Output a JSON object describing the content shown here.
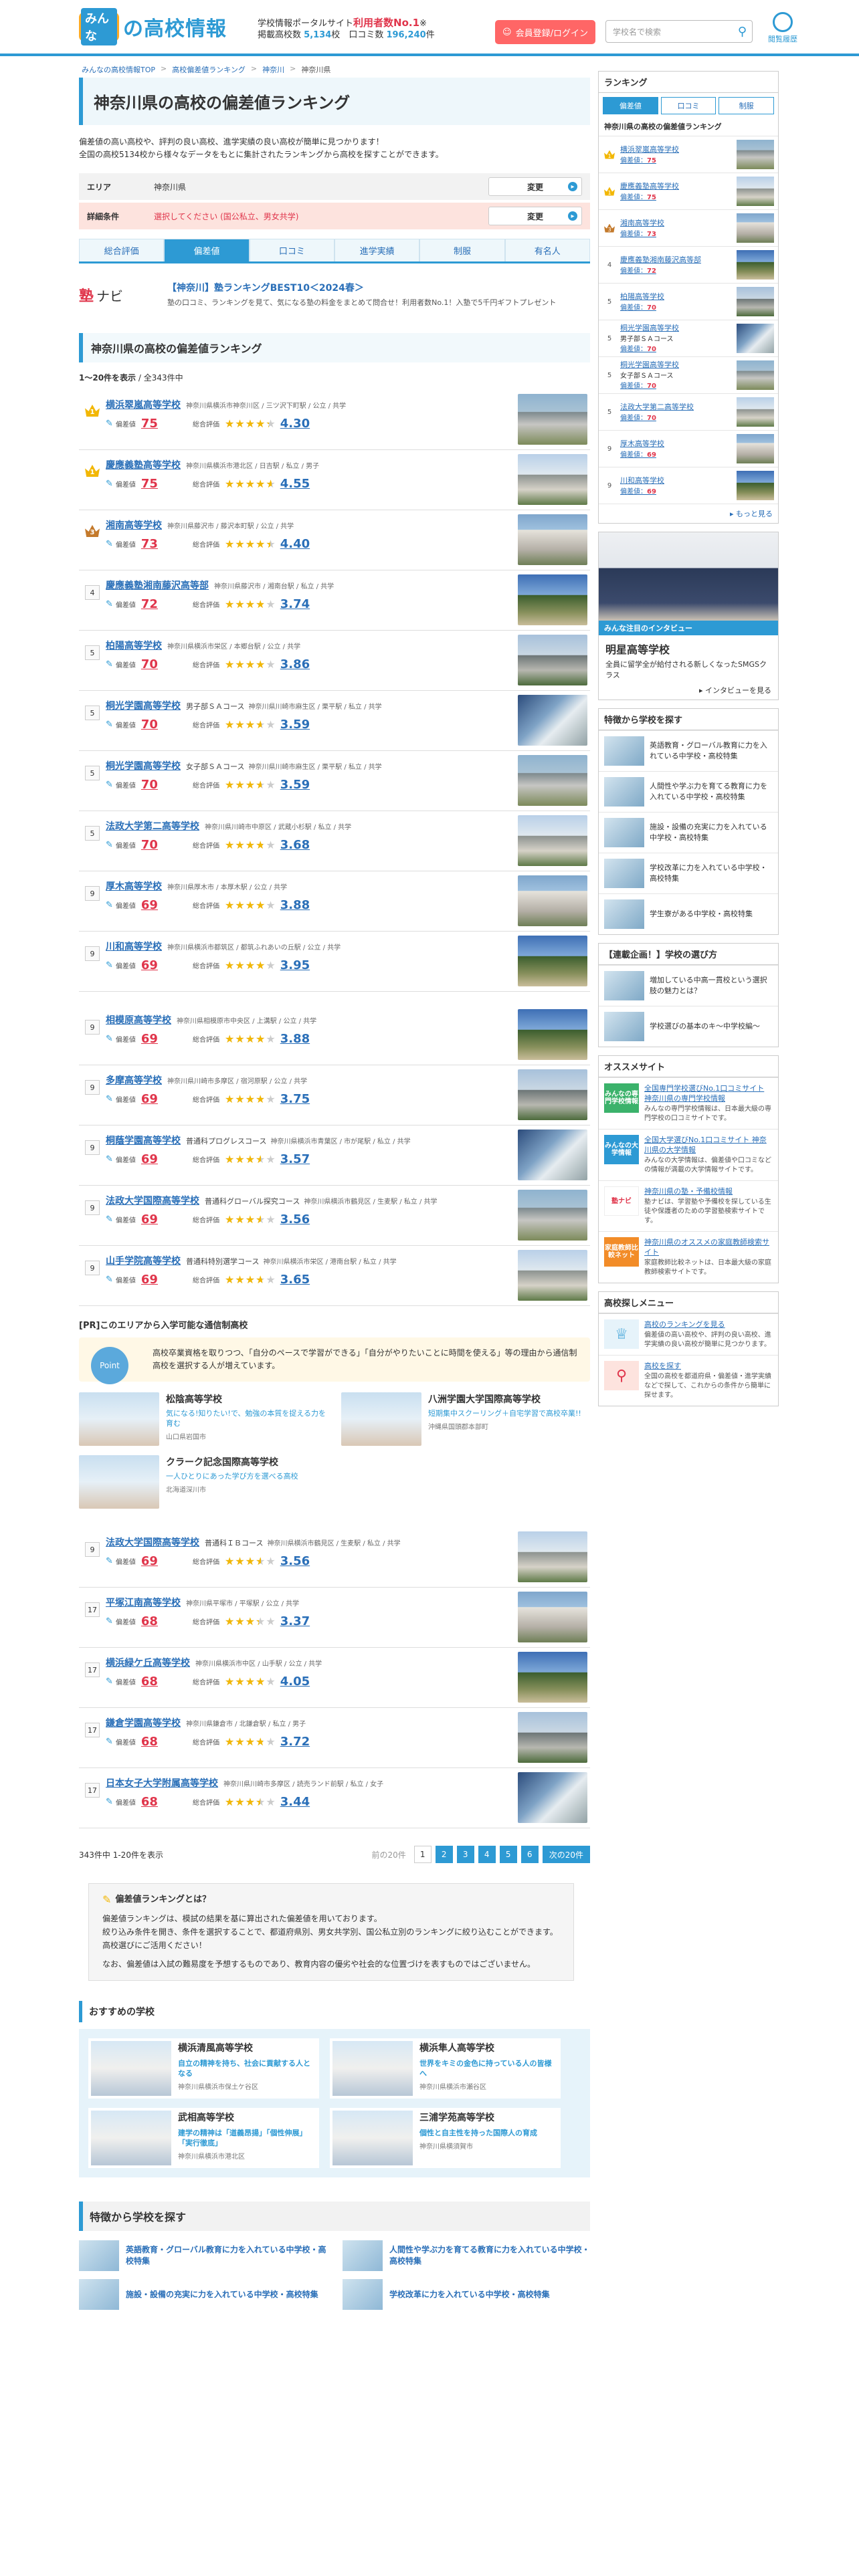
{
  "header": {
    "logo_small": "みんな",
    "logo_main": "の高校情報",
    "tagline_1": "学校情報ポータルサイト",
    "tagline_hl": "利用者数No.1",
    "tagline_mark": "※",
    "tagline_2a": "掲載高校数",
    "tagline_2b": "5,134",
    "tagline_2c": "校",
    "tagline_2d": "口コミ数",
    "tagline_2e": "196,240",
    "tagline_2f": "件",
    "login": "会員登録/ログイン",
    "search_placeholder": "学校名で検索",
    "history": "閲覧履歴"
  },
  "breadcrumb": [
    "みんなの高校情報TOP",
    "高校偏差値ランキング",
    "神奈川",
    "神奈川県"
  ],
  "title": "神奈川県の高校の偏差値ランキング",
  "lead_1": "偏差値の高い高校や、評判の良い高校、進学実績の良い高校が簡単に見つかります！",
  "lead_2": "全国の高校5134校から様々なデータをもとに集計されたランキングから高校を探すことができます。",
  "area": {
    "label": "エリア",
    "value": "神奈川県",
    "btn": "変更"
  },
  "detail": {
    "label": "詳細条件",
    "value": "選択してください (国公私立、男女共学)",
    "btn": "変更"
  },
  "tabs": [
    "総合評価",
    "偏差値",
    "口コミ",
    "進学実績",
    "制服",
    "有名人"
  ],
  "juku": {
    "logo": "塾",
    "logo2": "ナビ",
    "title": "【神奈川】塾ランキングBEST10＜2024春＞",
    "desc": "塾の口コミ、ランキングを見て、気になる塾の料金をまとめて問合せ！利用者数No.1！入塾で5千円ギフトプレゼント"
  },
  "section_title": "神奈川県の高校の偏差値ランキング",
  "count": {
    "range": "1〜20件を表示",
    "total": "全343件中"
  },
  "labels": {
    "hensachi": "偏差値",
    "sougo": "総合評価"
  },
  "schools1": [
    {
      "rank": "1",
      "name": "横浜翠嵐高等学校",
      "course": "",
      "addr": "神奈川県横浜市神奈川区 / 三ツ沢下町駅 / 公立 / 共学",
      "hensachi": "75",
      "score": "4.30"
    },
    {
      "rank": "1",
      "name": "慶應義塾高等学校",
      "course": "",
      "addr": "神奈川県横浜市港北区 / 日吉駅 / 私立 / 男子",
      "hensachi": "75",
      "score": "4.55"
    },
    {
      "rank": "3",
      "name": "湘南高等学校",
      "course": "",
      "addr": "神奈川県藤沢市 / 藤沢本町駅 / 公立 / 共学",
      "hensachi": "73",
      "score": "4.40"
    },
    {
      "rank": "4",
      "name": "慶應義塾湘南藤沢高等部",
      "course": "",
      "addr": "神奈川県藤沢市 / 湘南台駅 / 私立 / 共学",
      "hensachi": "72",
      "score": "3.74"
    },
    {
      "rank": "5",
      "name": "柏陽高等学校",
      "course": "",
      "addr": "神奈川県横浜市栄区 / 本郷台駅 / 公立 / 共学",
      "hensachi": "70",
      "score": "3.86"
    },
    {
      "rank": "5",
      "name": "桐光学園高等学校",
      "course": "男子部ＳＡコース",
      "addr": "神奈川県川崎市麻生区 / 栗平駅 / 私立 / 共学",
      "hensachi": "70",
      "score": "3.59"
    },
    {
      "rank": "5",
      "name": "桐光学園高等学校",
      "course": "女子部ＳＡコース",
      "addr": "神奈川県川崎市麻生区 / 栗平駅 / 私立 / 共学",
      "hensachi": "70",
      "score": "3.59"
    },
    {
      "rank": "5",
      "name": "法政大学第二高等学校",
      "course": "",
      "addr": "神奈川県川崎市中原区 / 武蔵小杉駅 / 私立 / 共学",
      "hensachi": "70",
      "score": "3.68"
    },
    {
      "rank": "9",
      "name": "厚木高等学校",
      "course": "",
      "addr": "神奈川県厚木市 / 本厚木駅 / 公立 / 共学",
      "hensachi": "69",
      "score": "3.88"
    },
    {
      "rank": "9",
      "name": "川和高等学校",
      "course": "",
      "addr": "神奈川県横浜市都筑区 / 都筑ふれあいの丘駅 / 公立 / 共学",
      "hensachi": "69",
      "score": "3.95"
    }
  ],
  "schools2": [
    {
      "rank": "9",
      "name": "相模原高等学校",
      "course": "",
      "addr": "神奈川県相模原市中央区 / 上溝駅 / 公立 / 共学",
      "hensachi": "69",
      "score": "3.88"
    },
    {
      "rank": "9",
      "name": "多摩高等学校",
      "course": "",
      "addr": "神奈川県川崎市多摩区 / 宿河原駅 / 公立 / 共学",
      "hensachi": "69",
      "score": "3.75"
    },
    {
      "rank": "9",
      "name": "桐蔭学園高等学校",
      "course": "普通科プログレスコース",
      "addr": "神奈川県横浜市青葉区 / 市が尾駅 / 私立 / 共学",
      "hensachi": "69",
      "score": "3.57"
    },
    {
      "rank": "9",
      "name": "法政大学国際高等学校",
      "course": "普通科グローバル探究コース",
      "addr": "神奈川県横浜市鶴見区 / 生麦駅 / 私立 / 共学",
      "hensachi": "69",
      "score": "3.56"
    },
    {
      "rank": "9",
      "name": "山手学院高等学校",
      "course": "普通科特別選学コース",
      "addr": "神奈川県横浜市栄区 / 港南台駅 / 私立 / 共学",
      "hensachi": "69",
      "score": "3.65"
    }
  ],
  "pr": {
    "title": "[PR]このエリアから入学可能な通信制高校",
    "point": "Point",
    "text": "高校卒業資格を取りつつ、「自分のペースで学習ができる」「自分がやりたいことに時間を使える」等の理由から通信制高校を選択する人が増えています。",
    "cards": [
      {
        "name": "松陰高等学校",
        "catch": "気になる!知りたい!で、勉強の本質を捉える力を育む",
        "addr": "山口県岩国市"
      },
      {
        "name": "八洲学園大学国際高等学校",
        "catch": "短期集中スクーリング＋自宅学習で高校卒業!!",
        "addr": "沖縄県国頭郡本部町"
      },
      {
        "name": "クラーク記念国際高等学校",
        "catch": "一人ひとりにあった学び方を選べる高校",
        "addr": "北海道深川市"
      }
    ]
  },
  "schools3": [
    {
      "rank": "9",
      "name": "法政大学国際高等学校",
      "course": "普通科ＩＢコース",
      "addr": "神奈川県横浜市鶴見区 / 生麦駅 / 私立 / 共学",
      "hensachi": "69",
      "score": "3.56"
    },
    {
      "rank": "17",
      "name": "平塚江南高等学校",
      "course": "",
      "addr": "神奈川県平塚市 / 平塚駅 / 公立 / 共学",
      "hensachi": "68",
      "score": "3.37"
    },
    {
      "rank": "17",
      "name": "横浜緑ケ丘高等学校",
      "course": "",
      "addr": "神奈川県横浜市中区 / 山手駅 / 公立 / 共学",
      "hensachi": "68",
      "score": "4.05"
    },
    {
      "rank": "17",
      "name": "鎌倉学園高等学校",
      "course": "",
      "addr": "神奈川県鎌倉市 / 北鎌倉駅 / 私立 / 男子",
      "hensachi": "68",
      "score": "3.72"
    },
    {
      "rank": "17",
      "name": "日本女子大学附属高等学校",
      "course": "",
      "addr": "神奈川県川崎市多摩区 / 読売ランド前駅 / 私立 / 女子",
      "hensachi": "68",
      "score": "3.44"
    }
  ],
  "pagination": {
    "info": "343件中 1-20件を表示",
    "prev": "前の20件",
    "pages": [
      "1",
      "2",
      "3",
      "4",
      "5",
      "6"
    ],
    "next": "次の20件"
  },
  "about": {
    "title": "偏差値ランキングとは？",
    "p1": "偏差値ランキングは、模試の結果を基に算出された偏差値を用いております。",
    "p2": "絞り込み条件を開き、条件を選択することで、都道府県別、男女共学別、国公私立別のランキングに絞り込むことができます。高校選びにご活用ください！",
    "p3": "なお、偏差値は入試の難易度を予想するものであり、教育内容の優劣や社会的な位置づけを表すものではございません。"
  },
  "recommend": {
    "title": "おすすめの学校",
    "cards": [
      {
        "name": "横浜清風高等学校",
        "catch": "自立の精神を持ち、社会に貢献する人となる",
        "addr": "神奈川県横浜市保土ケ谷区"
      },
      {
        "name": "横浜隼人高等学校",
        "catch": "世界をキミの金色に持っている人の皆様へ",
        "addr": "神奈川県横浜市瀬谷区"
      },
      {
        "name": "武相高等学校",
        "catch": "建学の精神は「道義昂揚」「個性伸展」「実行徹底」",
        "addr": "神奈川県横浜市港北区"
      },
      {
        "name": "三浦学苑高等学校",
        "catch": "個性と自主性を持った国際人の育成",
        "addr": "神奈川県横須賀市"
      }
    ]
  },
  "features": {
    "title": "特徴から学校を探す",
    "items": [
      "英語教育・グローバル教育に力を入れている中学校・高校特集",
      "人間性や学ぶ力を育てる教育に力を入れている中学校・高校特集",
      "施設・設備の充実に力を入れている中学校・高校特集",
      "学校改革に力を入れている中学校・高校特集"
    ]
  },
  "sidebar": {
    "ranking_title": "ランキング",
    "tabs": [
      "偏差値",
      "口コミ",
      "制服"
    ],
    "sub": "神奈川県の高校の偏差値ランキング",
    "hensachi_label": "偏差値：",
    "items": [
      {
        "rank": "1",
        "name": "横浜翠嵐高等学校",
        "course": "",
        "h": "75"
      },
      {
        "rank": "1",
        "name": "慶應義塾高等学校",
        "course": "",
        "h": "75"
      },
      {
        "rank": "3",
        "name": "湘南高等学校",
        "course": "",
        "h": "73"
      },
      {
        "rank": "4",
        "name": "慶應義塾湘南藤沢高等部",
        "course": "",
        "h": "72"
      },
      {
        "rank": "5",
        "name": "柏陽高等学校",
        "course": "",
        "h": "70"
      },
      {
        "rank": "5",
        "name": "桐光学園高等学校",
        "course": "男子部ＳＡコース",
        "h": "70"
      },
      {
        "rank": "5",
        "name": "桐光学園高等学校",
        "course": "女子部ＳＡコース",
        "h": "70"
      },
      {
        "rank": "5",
        "name": "法政大学第二高等学校",
        "course": "",
        "h": "70"
      },
      {
        "rank": "9",
        "name": "厚木高等学校",
        "course": "",
        "h": "69"
      },
      {
        "rank": "9",
        "name": "川和高等学校",
        "course": "",
        "h": "69"
      }
    ],
    "more": "もっと見る",
    "interview": {
      "bar": "みんな注目のインタビュー",
      "name": "明星高等学校",
      "desc": "全員に留学全が給付される新しくなったSMGSクラス",
      "link": "インタビューを見る"
    },
    "feat_title": "特徴から学校を探す",
    "feat_items": [
      "英語教育・グローバル教育に力を入れている中学校・高校特集",
      "人間性や学ぶ力を育てる教育に力を入れている中学校・高校特集",
      "施設・設備の充実に力を入れている中学校・高校特集",
      "学校改革に力を入れている中学校・高校特集",
      "学生寮がある中学校・高校特集"
    ],
    "choose_title": "【連載企画！】学校の選び方",
    "choose_items": [
      "増加している中高一貫校という選択肢の魅力とは？",
      "学校選びの基本のキ〜中学校編〜"
    ],
    "osusume_title": "オススメサイト",
    "osusume_items": [
      {
        "logo": "みんなの専門学校情報",
        "link": "全国専門学校選びNo.1口コミサイト 神奈川県の専門学校情報",
        "desc": "みんなの専門学校情報は、日本最大級の専門学校の口コミサイトです。"
      },
      {
        "logo": "みんなの大学情報",
        "link": "全国大学選びNo.1口コミサイト 神奈川県の大学情報",
        "desc": "みんなの大学情報は、偏差値や口コミなどの情報が満載の大学情報サイトです。"
      },
      {
        "logo": "塾ナビ",
        "link": "神奈川県の塾・予備校情報",
        "desc": "塾ナビは、学習塾や予備校を探している生徒や保護者のための学習塾検索サイトです。"
      },
      {
        "logo": "家庭教師比較ネット",
        "link": "神奈川県のオススメの家庭教師検索サイト",
        "desc": "家庭教師比較ネットは、日本最大級の家庭教師検索サイトです。"
      }
    ],
    "menu_title": "高校探しメニュー",
    "menu_items": [
      {
        "link": "高校のランキングを見る",
        "desc": "偏差値の高い高校や、評判の良い高校、進学実績の良い高校が簡単に見つかります。"
      },
      {
        "link": "高校を探す",
        "desc": "全国の高校を都道府県・偏差値・進学実績などで探して、これからの条件から簡単に探せます。"
      }
    ]
  }
}
